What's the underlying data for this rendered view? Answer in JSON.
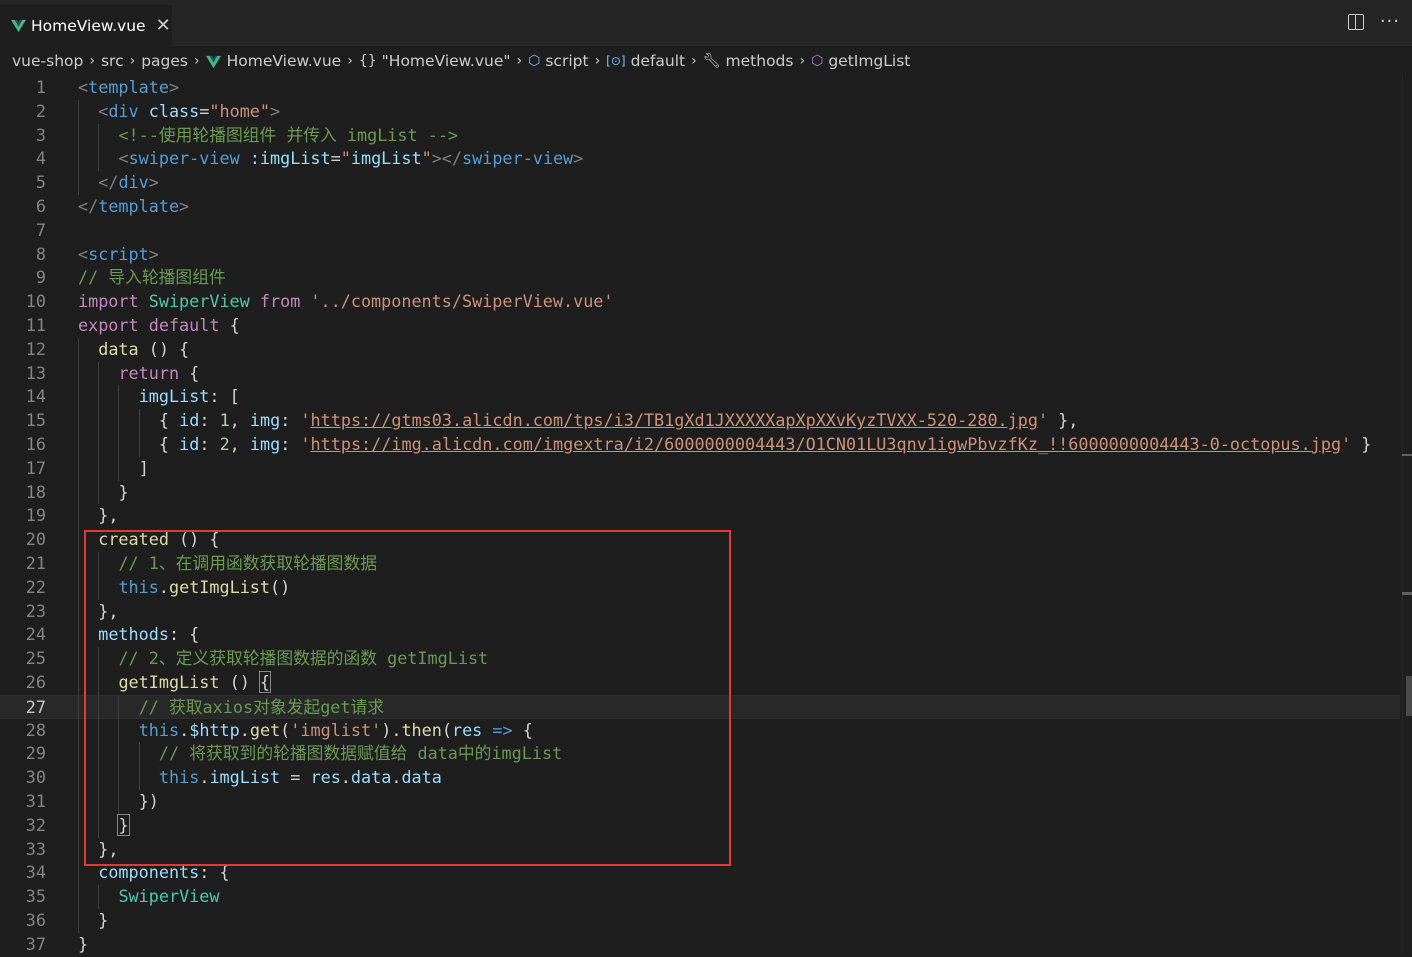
{
  "tab": {
    "label": "HomeView.vue",
    "close": "✕",
    "icon": "vue-icon"
  },
  "actions": {
    "split": "split-editor-icon",
    "more": "···"
  },
  "breadcrumb": [
    {
      "label": "vue-shop",
      "icon": ""
    },
    {
      "label": "src",
      "icon": ""
    },
    {
      "label": "pages",
      "icon": ""
    },
    {
      "label": "HomeView.vue",
      "icon": "vue-icon"
    },
    {
      "label": "\"HomeView.vue\"",
      "icon": "braces-icon"
    },
    {
      "label": "script",
      "icon": "cube-icon"
    },
    {
      "label": "default",
      "icon": "variable-icon"
    },
    {
      "label": "methods",
      "icon": "wrench-icon"
    },
    {
      "label": "getImgList",
      "icon": "method-icon"
    }
  ],
  "editor": {
    "current_line": 27,
    "lines": [
      {
        "n": "1",
        "indent": 0,
        "tokens": [
          [
            "tg",
            "<"
          ],
          [
            "tn",
            "template"
          ],
          [
            "tg",
            ">"
          ]
        ]
      },
      {
        "n": "2",
        "indent": 1,
        "tokens": [
          [
            "tg",
            "<"
          ],
          [
            "tn",
            "div"
          ],
          [
            "pl",
            " "
          ],
          [
            "an",
            "class"
          ],
          [
            "pl",
            "="
          ],
          [
            "st",
            "\"home\""
          ],
          [
            "tg",
            ">"
          ]
        ]
      },
      {
        "n": "3",
        "indent": 2,
        "tokens": [
          [
            "cm",
            "<!--使用轮播图组件 并传入 imgList -->"
          ]
        ]
      },
      {
        "n": "4",
        "indent": 2,
        "tokens": [
          [
            "tg",
            "<"
          ],
          [
            "tn",
            "swiper-view"
          ],
          [
            "pl",
            " "
          ],
          [
            "an",
            ":imgList"
          ],
          [
            "pl",
            "="
          ],
          [
            "st",
            "\""
          ],
          [
            "vr",
            "imgList"
          ],
          [
            "st",
            "\""
          ],
          [
            "tg",
            "></"
          ],
          [
            "tn",
            "swiper-view"
          ],
          [
            "tg",
            ">"
          ]
        ]
      },
      {
        "n": "5",
        "indent": 1,
        "tokens": [
          [
            "tg",
            "</"
          ],
          [
            "tn",
            "div"
          ],
          [
            "tg",
            ">"
          ]
        ]
      },
      {
        "n": "6",
        "indent": 0,
        "tokens": [
          [
            "tg",
            "</"
          ],
          [
            "tn",
            "template"
          ],
          [
            "tg",
            ">"
          ]
        ]
      },
      {
        "n": "7",
        "indent": 0,
        "tokens": []
      },
      {
        "n": "8",
        "indent": 0,
        "tokens": [
          [
            "tg",
            "<"
          ],
          [
            "tn",
            "script"
          ],
          [
            "tg",
            ">"
          ]
        ]
      },
      {
        "n": "9",
        "indent": 0,
        "tokens": [
          [
            "cm",
            "// 导入轮播图组件"
          ]
        ]
      },
      {
        "n": "10",
        "indent": 0,
        "tokens": [
          [
            "kw",
            "import"
          ],
          [
            "pl",
            " "
          ],
          [
            "cl",
            "SwiperView"
          ],
          [
            "pl",
            " "
          ],
          [
            "kw",
            "from"
          ],
          [
            "pl",
            " "
          ],
          [
            "st",
            "'../components/SwiperView.vue'"
          ]
        ]
      },
      {
        "n": "11",
        "indent": 0,
        "tokens": [
          [
            "kw",
            "export"
          ],
          [
            "pl",
            " "
          ],
          [
            "kw",
            "default"
          ],
          [
            "pl",
            " {"
          ]
        ]
      },
      {
        "n": "12",
        "indent": 1,
        "tokens": [
          [
            "fn",
            "data"
          ],
          [
            "pl",
            " () {"
          ]
        ]
      },
      {
        "n": "13",
        "indent": 2,
        "tokens": [
          [
            "kw",
            "return"
          ],
          [
            "pl",
            " {"
          ]
        ]
      },
      {
        "n": "14",
        "indent": 3,
        "tokens": [
          [
            "vr",
            "imgList"
          ],
          [
            "pl",
            ": ["
          ]
        ]
      },
      {
        "n": "15",
        "indent": 4,
        "tokens": [
          [
            "pl",
            "{ "
          ],
          [
            "vr",
            "id"
          ],
          [
            "pl",
            ": "
          ],
          [
            "nm",
            "1"
          ],
          [
            "pl",
            ", "
          ],
          [
            "vr",
            "img"
          ],
          [
            "pl",
            ": "
          ],
          [
            "st",
            "'"
          ],
          [
            "url",
            "https://gtms03.alicdn.com/tps/i3/TB1gXd1JXXXXXapXpXXvKyzTVXX-520-280.jpg"
          ],
          [
            "st",
            "'"
          ],
          [
            "pl",
            " },"
          ]
        ]
      },
      {
        "n": "16",
        "indent": 4,
        "tokens": [
          [
            "pl",
            "{ "
          ],
          [
            "vr",
            "id"
          ],
          [
            "pl",
            ": "
          ],
          [
            "nm",
            "2"
          ],
          [
            "pl",
            ", "
          ],
          [
            "vr",
            "img"
          ],
          [
            "pl",
            ": "
          ],
          [
            "st",
            "'"
          ],
          [
            "url",
            "https://img.alicdn.com/imgextra/i2/6000000004443/O1CN01LU3qnv1igwPbvzfKz_!!6000000004443-0-octopus.jpg"
          ],
          [
            "st",
            "'"
          ],
          [
            "pl",
            " }"
          ]
        ]
      },
      {
        "n": "17",
        "indent": 3,
        "tokens": [
          [
            "pl",
            "]"
          ]
        ]
      },
      {
        "n": "18",
        "indent": 2,
        "tokens": [
          [
            "pl",
            "}"
          ]
        ]
      },
      {
        "n": "19",
        "indent": 1,
        "tokens": [
          [
            "pl",
            "},"
          ]
        ]
      },
      {
        "n": "20",
        "indent": 1,
        "tokens": [
          [
            "fn",
            "created"
          ],
          [
            "pl",
            " () {"
          ]
        ]
      },
      {
        "n": "21",
        "indent": 2,
        "tokens": [
          [
            "cm",
            "// 1、在调用函数获取轮播图数据"
          ]
        ]
      },
      {
        "n": "22",
        "indent": 2,
        "tokens": [
          [
            "th",
            "this"
          ],
          [
            "pl",
            "."
          ],
          [
            "fn",
            "getImgList"
          ],
          [
            "pl",
            "()"
          ]
        ]
      },
      {
        "n": "23",
        "indent": 1,
        "tokens": [
          [
            "pl",
            "},"
          ]
        ]
      },
      {
        "n": "24",
        "indent": 1,
        "tokens": [
          [
            "vr",
            "methods"
          ],
          [
            "pl",
            ": {"
          ]
        ]
      },
      {
        "n": "25",
        "indent": 2,
        "tokens": [
          [
            "cm",
            "// 2、定义获取轮播图数据的函数 getImgList"
          ]
        ]
      },
      {
        "n": "26",
        "indent": 2,
        "tokens": [
          [
            "fn",
            "getImgList"
          ],
          [
            "pl",
            " () "
          ],
          [
            "brk",
            "{"
          ]
        ]
      },
      {
        "n": "27",
        "indent": 3,
        "tokens": [
          [
            "cm",
            "// 获取axios对象发起get请求"
          ]
        ]
      },
      {
        "n": "28",
        "indent": 3,
        "tokens": [
          [
            "th",
            "this"
          ],
          [
            "pl",
            "."
          ],
          [
            "vr",
            "$http"
          ],
          [
            "pl",
            "."
          ],
          [
            "fn",
            "get"
          ],
          [
            "pl",
            "("
          ],
          [
            "st",
            "'imglist'"
          ],
          [
            "pl",
            ")."
          ],
          [
            "fn",
            "then"
          ],
          [
            "pl",
            "("
          ],
          [
            "vr",
            "res"
          ],
          [
            "pl",
            " "
          ],
          [
            "th",
            "=>"
          ],
          [
            "pl",
            " {"
          ]
        ]
      },
      {
        "n": "29",
        "indent": 4,
        "tokens": [
          [
            "cm",
            "// 将获取到的轮播图数据赋值给 data中的imgList"
          ]
        ]
      },
      {
        "n": "30",
        "indent": 4,
        "tokens": [
          [
            "th",
            "this"
          ],
          [
            "pl",
            "."
          ],
          [
            "vr",
            "imgList"
          ],
          [
            "pl",
            " = "
          ],
          [
            "vr",
            "res"
          ],
          [
            "pl",
            "."
          ],
          [
            "vr",
            "data"
          ],
          [
            "pl",
            "."
          ],
          [
            "vr",
            "data"
          ]
        ]
      },
      {
        "n": "31",
        "indent": 3,
        "tokens": [
          [
            "pl",
            "})"
          ]
        ]
      },
      {
        "n": "32",
        "indent": 2,
        "tokens": [
          [
            "brk",
            "}"
          ]
        ]
      },
      {
        "n": "33",
        "indent": 1,
        "tokens": [
          [
            "pl",
            "},"
          ]
        ]
      },
      {
        "n": "34",
        "indent": 1,
        "tokens": [
          [
            "vr",
            "components"
          ],
          [
            "pl",
            ": {"
          ]
        ]
      },
      {
        "n": "35",
        "indent": 2,
        "tokens": [
          [
            "cl",
            "SwiperView"
          ]
        ]
      },
      {
        "n": "36",
        "indent": 1,
        "tokens": [
          [
            "pl",
            "}"
          ]
        ]
      },
      {
        "n": "37",
        "indent": 0,
        "tokens": [
          [
            "pl",
            "}"
          ]
        ]
      }
    ]
  },
  "colors": {
    "highlight_box": "#e53935",
    "vue_green": "#41b883",
    "background": "#1e1e1e"
  }
}
